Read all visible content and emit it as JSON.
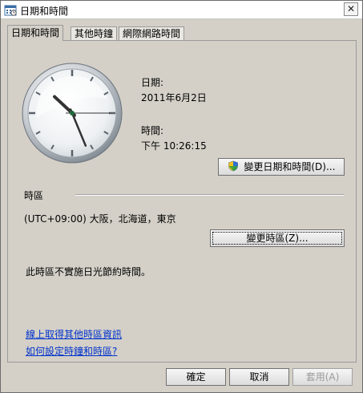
{
  "window": {
    "title": "日期和時間",
    "close_symbol": "✕"
  },
  "tabs": [
    {
      "label": "日期和時間",
      "active": true
    },
    {
      "label": "其他時鐘",
      "active": false
    },
    {
      "label": "網際網路時間",
      "active": false
    }
  ],
  "clock": {
    "hour": 10,
    "minute": 26,
    "second": 15
  },
  "date": {
    "heading": "日期:",
    "value": "2011年6月2日"
  },
  "time": {
    "heading": "時間:",
    "value": "下午 10:26:15"
  },
  "buttons": {
    "change_datetime": "變更日期和時間(D)...",
    "change_timezone": "變更時區(Z)...",
    "ok": "確定",
    "cancel": "取消",
    "apply": "套用(A)"
  },
  "timezone": {
    "heading": "時區",
    "value": "(UTC+09:00) 大阪，北海道，東京",
    "dst_note": "此時區不實施日光節約時間。"
  },
  "links": {
    "more_info": "線上取得其他時區資訊",
    "how_to": "如何設定時鐘和時區?"
  },
  "colors": {
    "link": "#0033cc",
    "panel": "#d4d0c8"
  }
}
